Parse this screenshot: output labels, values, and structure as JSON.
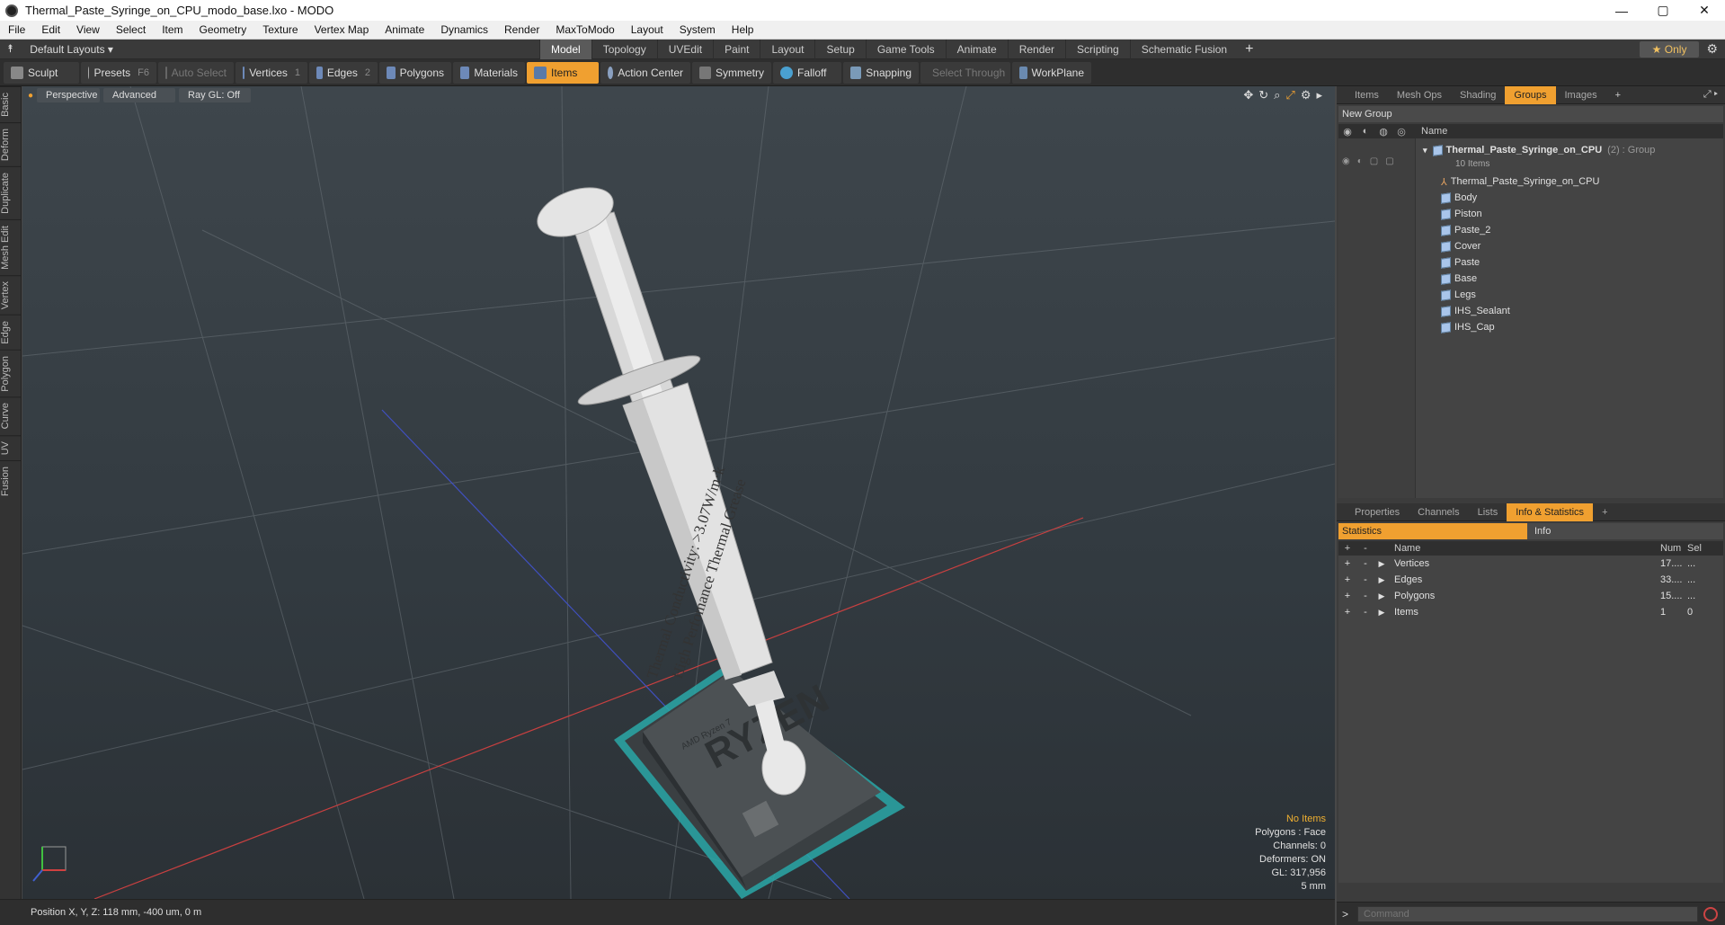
{
  "window": {
    "title": "Thermal_Paste_Syringe_on_CPU_modo_base.lxo - MODO",
    "min_glyph": "—",
    "max_glyph": "▢",
    "close_glyph": "✕"
  },
  "menubar": {
    "items": [
      "File",
      "Edit",
      "View",
      "Select",
      "Item",
      "Geometry",
      "Texture",
      "Vertex Map",
      "Animate",
      "Dynamics",
      "Render",
      "MaxToModo",
      "Layout",
      "System",
      "Help"
    ]
  },
  "layoutbar": {
    "layouts_label": "Default Layouts ▾",
    "tabs": [
      "Model",
      "Topology",
      "UVEdit",
      "Paint",
      "Layout",
      "Setup",
      "Game Tools",
      "Animate",
      "Render",
      "Scripting",
      "Schematic Fusion"
    ],
    "active_tab": "Model",
    "add_glyph": "+",
    "only_label": "★ Only",
    "gear_glyph": "⚙"
  },
  "toolbar": {
    "sculpt": "Sculpt",
    "presets": "Presets",
    "presets_key": "F6",
    "auto_select": "Auto Select",
    "vertices": "Vertices",
    "vertices_key": "1",
    "edges": "Edges",
    "edges_key": "2",
    "polygons": "Polygons",
    "materials": "Materials",
    "items": "Items",
    "action_center": "Action Center",
    "symmetry": "Symmetry",
    "falloff": "Falloff",
    "snapping": "Snapping",
    "select_through": "Select Through",
    "workplane": "WorkPlane"
  },
  "leftstrip": [
    "Basic",
    "Deform",
    "Duplicate",
    "Mesh Edit",
    "Vertex",
    "Edge",
    "Polygon",
    "Curve",
    "UV",
    "Fusion"
  ],
  "viewport": {
    "perspective": "Perspective",
    "advanced": "Advanced",
    "raygl": "Ray GL: Off",
    "label_line1": "Thermal Conductivity: >3.07W/m·k",
    "label_line2": "High Perfomance Thermal Grease",
    "cpu_brand": "RYZEN",
    "cpu_sub": "AMD Ryzen 7",
    "stats": {
      "no_items": "No Items",
      "polygons": "Polygons : Face",
      "channels": "Channels: 0",
      "deformers": "Deformers: ON",
      "gl": "GL: 317,956",
      "scale": "5 mm"
    }
  },
  "statusbar": {
    "position": "Position X, Y, Z:   118 mm, -400 um, 0 m"
  },
  "groups_panel": {
    "tabs": [
      "Items",
      "Mesh Ops",
      "Shading",
      "Groups",
      "Images"
    ],
    "active_tab": "Groups",
    "add_glyph": "+",
    "new_group": "New Group",
    "name_header": "Name",
    "group_name": "Thermal_Paste_Syringe_on_CPU",
    "group_suffix": "(2) : Group",
    "group_count": "10 Items",
    "items": [
      "Thermal_Paste_Syringe_on_CPU",
      "Body",
      "Piston",
      "Paste_2",
      "Cover",
      "Paste",
      "Base",
      "Legs",
      "IHS_Sealant",
      "IHS_Cap"
    ]
  },
  "info_panel": {
    "tabs": [
      "Properties",
      "Channels",
      "Lists",
      "Info & Statistics"
    ],
    "active_tab": "Info & Statistics",
    "add_glyph": "+",
    "statistics_tab": "Statistics",
    "info_tab": "Info",
    "headers": {
      "name": "Name",
      "num": "Num",
      "sel": "Sel"
    },
    "rows": [
      {
        "name": "Vertices",
        "num": "17....",
        "sel": "..."
      },
      {
        "name": "Edges",
        "num": "33....",
        "sel": "..."
      },
      {
        "name": "Polygons",
        "num": "15....",
        "sel": "..."
      },
      {
        "name": "Items",
        "num": "1",
        "sel": "0"
      }
    ]
  },
  "command": {
    "prompt": ">",
    "placeholder": "Command"
  },
  "colors": {
    "accent": "#f0a030",
    "viewport_bg": "#3a4248",
    "cpu_teal": "#2aa8a8"
  }
}
